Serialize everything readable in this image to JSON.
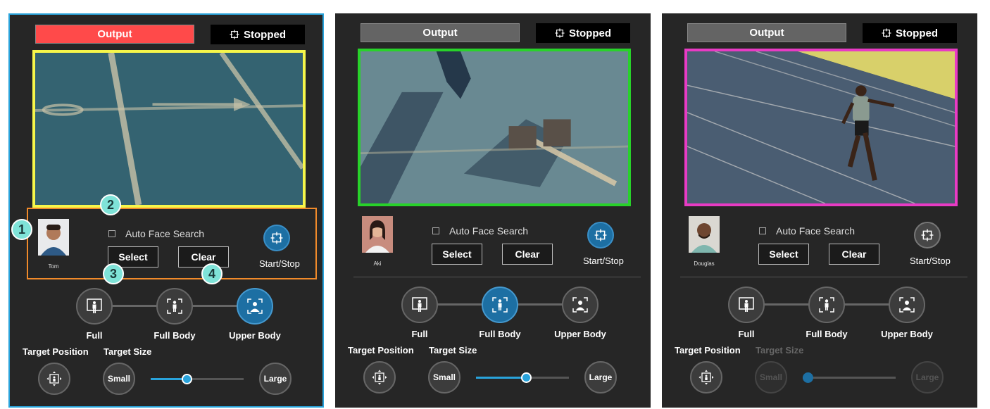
{
  "panels": [
    {
      "output_label": "Output",
      "output_active": true,
      "status_label": "Stopped",
      "frame_color": "#f6f64a",
      "person_name": "Tom",
      "auto_face_search_label": "Auto Face Search",
      "select_label": "Select",
      "clear_label": "Clear",
      "start_stop_label": "Start/Stop",
      "modes": [
        "Full",
        "Full Body",
        "Upper Body"
      ],
      "active_mode": 2,
      "target_position_label": "Target Position",
      "target_size_label": "Target Size",
      "target_size_enabled": true,
      "small_label": "Small",
      "large_label": "Large",
      "size_level": 0.38
    },
    {
      "output_label": "Output",
      "output_active": false,
      "status_label": "Stopped",
      "frame_color": "#28d22a",
      "person_name": "Aki",
      "auto_face_search_label": "Auto Face Search",
      "select_label": "Select",
      "clear_label": "Clear",
      "start_stop_label": "Start/Stop",
      "modes": [
        "Full",
        "Full Body",
        "Upper Body"
      ],
      "active_mode": 1,
      "target_position_label": "Target Position",
      "target_size_label": "Target Size",
      "target_size_enabled": true,
      "small_label": "Small",
      "large_label": "Large",
      "size_level": 0.55
    },
    {
      "output_label": "Output",
      "output_active": false,
      "status_label": "Stopped",
      "frame_color": "#e83bc4",
      "person_name": "Douglas",
      "auto_face_search_label": "Auto Face Search",
      "select_label": "Select",
      "clear_label": "Clear",
      "start_stop_label": "Start/Stop",
      "modes": [
        "Full",
        "Full Body",
        "Upper Body"
      ],
      "active_mode": -1,
      "target_position_label": "Target Position",
      "target_size_label": "Target Size",
      "target_size_enabled": false,
      "small_label": "Small",
      "large_label": "Large",
      "size_level": 0.0
    }
  ],
  "callouts": [
    "1",
    "2",
    "3",
    "4"
  ],
  "colors": {
    "output_active": "#ff4a4a",
    "accent": "#29a3db",
    "highlight_border": "#f08a2a",
    "callout": "#7fe3d8"
  },
  "icons": {
    "status": "crosshair-frame-icon",
    "start_stop": "crosshair-frame-icon",
    "mode_full": "full-frame-person-icon",
    "mode_full_body": "full-body-person-icon",
    "mode_upper_body": "upper-body-person-icon",
    "target_position": "target-position-icon"
  }
}
